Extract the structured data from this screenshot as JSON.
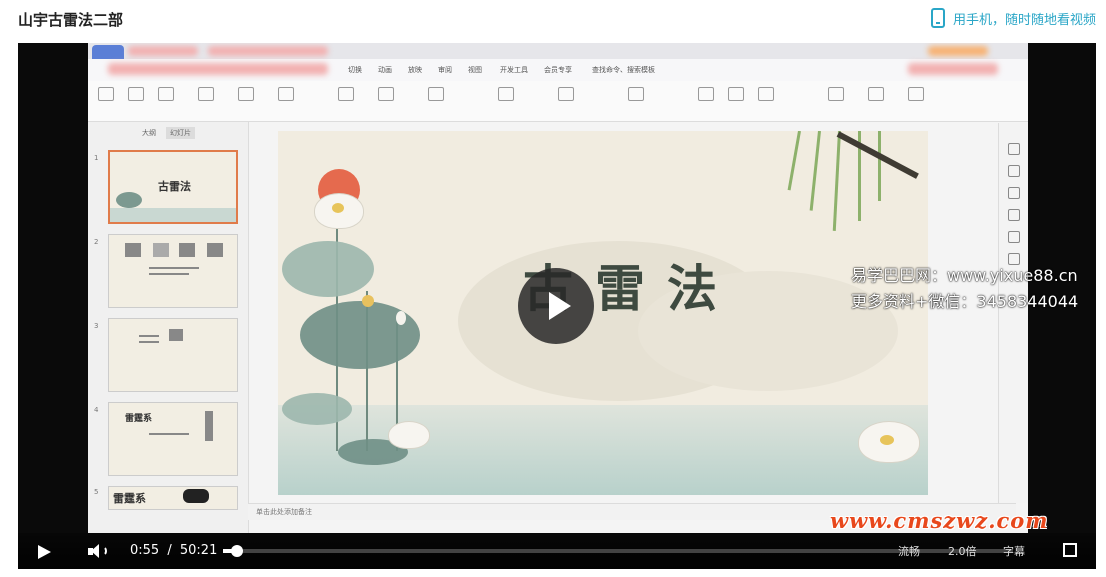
{
  "page": {
    "title": "山宇古雷法二部"
  },
  "header": {
    "mobile_link": "用手机，随时随地看视频",
    "mobile_icon": "phone-icon"
  },
  "wps": {
    "menu": [
      "切换",
      "动画",
      "放映",
      "审阅",
      "视图",
      "开发工具",
      "会员专享"
    ],
    "search_placeholder": "查找命令、搜索模板",
    "panel_tabs": [
      "大纲",
      "幻灯片"
    ],
    "notes_placeholder": "单击此处添加备注",
    "thumb_numbers": [
      "1",
      "2",
      "3",
      "4",
      "5"
    ],
    "thumb1_title": "古雷法",
    "thumb4_title": "雷霆系",
    "thumb5_title": "雷霆系",
    "slide_title": "古雷法"
  },
  "watermark": {
    "line1": "易学巴巴网：www.yixue88.cn",
    "line2": "更多资料+微信：3458344044"
  },
  "player": {
    "current_time": "0:55",
    "separator": "/",
    "duration": "50:21",
    "progress_fraction": 0.018,
    "speed_options": [
      "流畅",
      "2.0倍",
      "字幕"
    ],
    "state": "paused"
  },
  "site_watermark": "www.cmszwz.com",
  "colors": {
    "accent": "#2aa6c7",
    "watermark_red": "#e8481c",
    "slide_bg": "#f1ece0"
  }
}
